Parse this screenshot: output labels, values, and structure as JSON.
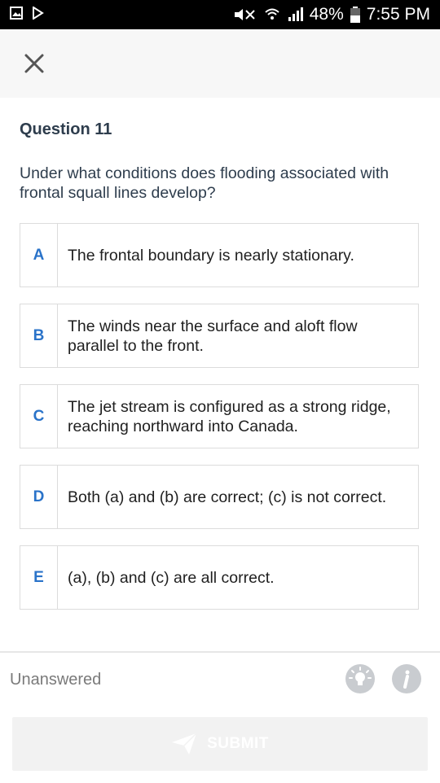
{
  "status_bar": {
    "battery": "48%",
    "time": "7:55 PM"
  },
  "question": {
    "number": "Question 11",
    "text": "Under what conditions does flooding associated with frontal squall lines develop?"
  },
  "options": [
    {
      "letter": "A",
      "text": "The frontal boundary is nearly stationary."
    },
    {
      "letter": "B",
      "text": "The winds near the surface and aloft flow parallel to the front."
    },
    {
      "letter": "C",
      "text": "The jet stream is configured as a strong ridge, reaching northward into Canada."
    },
    {
      "letter": "D",
      "text": "Both (a) and (b) are correct; (c) is not correct."
    },
    {
      "letter": "E",
      "text": "(a), (b) and (c) are all correct."
    }
  ],
  "footer": {
    "status": "Unanswered",
    "submit_label": "SUBMIT"
  },
  "colors": {
    "accent": "#2a73c9",
    "heading": "#2e3d4d"
  },
  "icons": {
    "close": "close-icon",
    "hint": "lightbulb-icon",
    "info": "info-icon",
    "submit": "send-icon"
  }
}
